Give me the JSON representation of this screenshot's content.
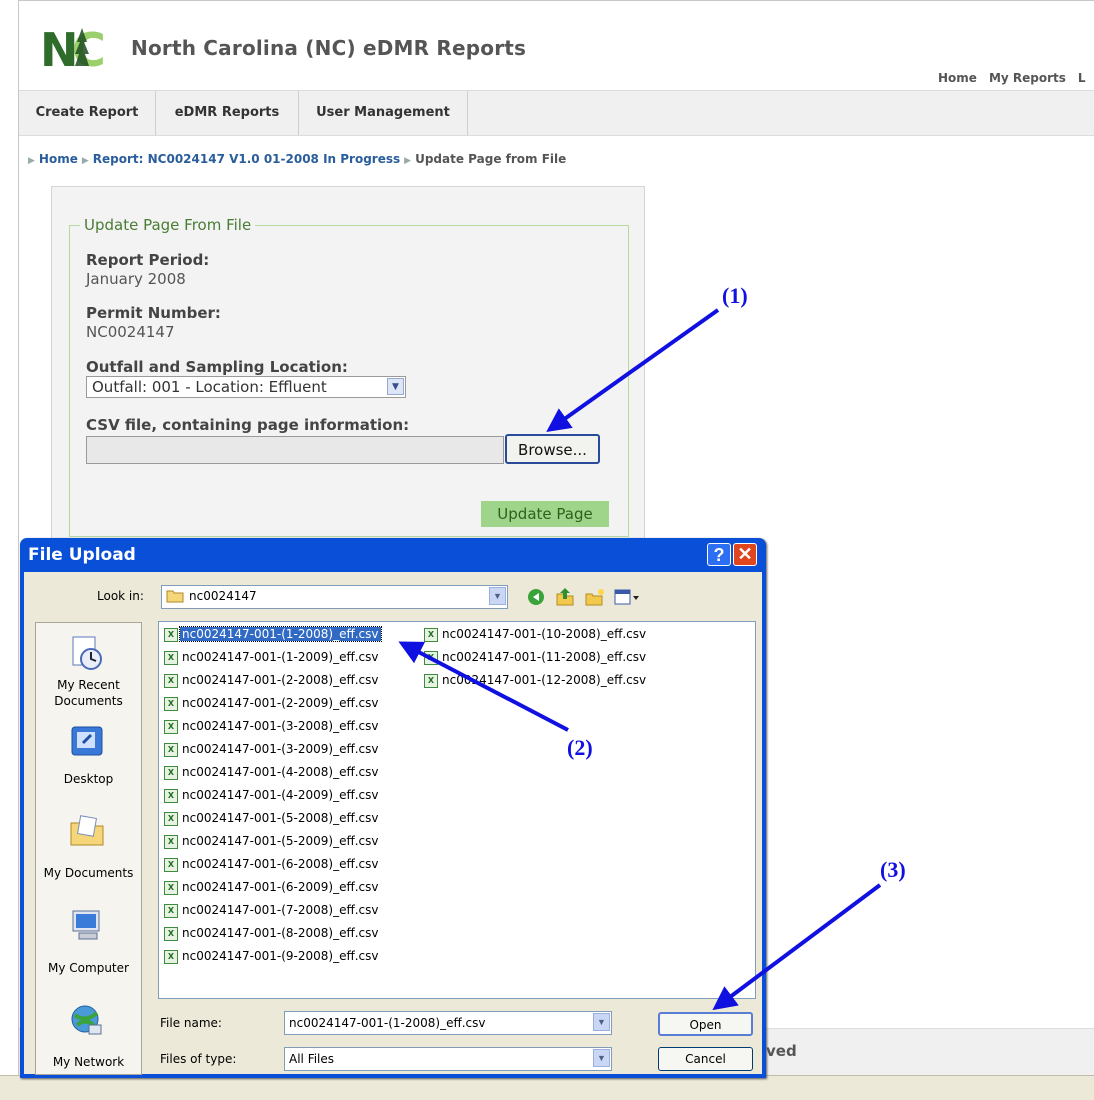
{
  "site": {
    "title": "North Carolina (NC) eDMR Reports",
    "top_links": [
      "Home",
      "My Reports",
      "L"
    ]
  },
  "nav": {
    "tabs": [
      "Create Report",
      "eDMR Reports",
      "User Management"
    ]
  },
  "breadcrumb": {
    "home": "Home",
    "report": "Report: NC0024147 V1.0 01-2008 In Progress",
    "current": "Update Page from File"
  },
  "form": {
    "legend": "Update Page From File",
    "report_period_label": "Report Period:",
    "report_period_value": "January 2008",
    "permit_label": "Permit Number:",
    "permit_value": "NC0024147",
    "outfall_label": "Outfall and Sampling Location:",
    "outfall_value": "Outfall: 001 - Location: Effluent",
    "csv_label": "CSV file, containing page information:",
    "browse_label": "Browse...",
    "update_label": "Update Page"
  },
  "footer": {
    "partial_text": "ved"
  },
  "dialog": {
    "title": "File Upload",
    "help_label": "?",
    "lookin_label": "Look in:",
    "lookin_value": "nc0024147",
    "places": [
      "My Recent Documents",
      "Desktop",
      "My Documents",
      "My Computer",
      "My Network"
    ],
    "files_col1": [
      "nc0024147-001-(1-2008)_eff.csv",
      "nc0024147-001-(1-2009)_eff.csv",
      "nc0024147-001-(2-2008)_eff.csv",
      "nc0024147-001-(2-2009)_eff.csv",
      "nc0024147-001-(3-2008)_eff.csv",
      "nc0024147-001-(3-2009)_eff.csv",
      "nc0024147-001-(4-2008)_eff.csv",
      "nc0024147-001-(4-2009)_eff.csv",
      "nc0024147-001-(5-2008)_eff.csv",
      "nc0024147-001-(5-2009)_eff.csv",
      "nc0024147-001-(6-2008)_eff.csv",
      "nc0024147-001-(6-2009)_eff.csv",
      "nc0024147-001-(7-2008)_eff.csv",
      "nc0024147-001-(8-2008)_eff.csv",
      "nc0024147-001-(9-2008)_eff.csv"
    ],
    "files_col2": [
      "nc0024147-001-(10-2008)_eff.csv",
      "nc0024147-001-(11-2008)_eff.csv",
      "nc0024147-001-(12-2008)_eff.csv"
    ],
    "file_name_label": "File name:",
    "file_name_value": "nc0024147-001-(1-2008)_eff.csv",
    "file_type_label": "Files of type:",
    "file_type_value": "All Files",
    "open_label": "Open",
    "cancel_label": "Cancel"
  },
  "annotations": [
    "(1)",
    "(2)",
    "(3)"
  ],
  "colors": {
    "annotation": "#1010e0",
    "dialog_title": "#0a4fd8",
    "selection": "#316ac5",
    "update_button": "#9ed58a"
  }
}
